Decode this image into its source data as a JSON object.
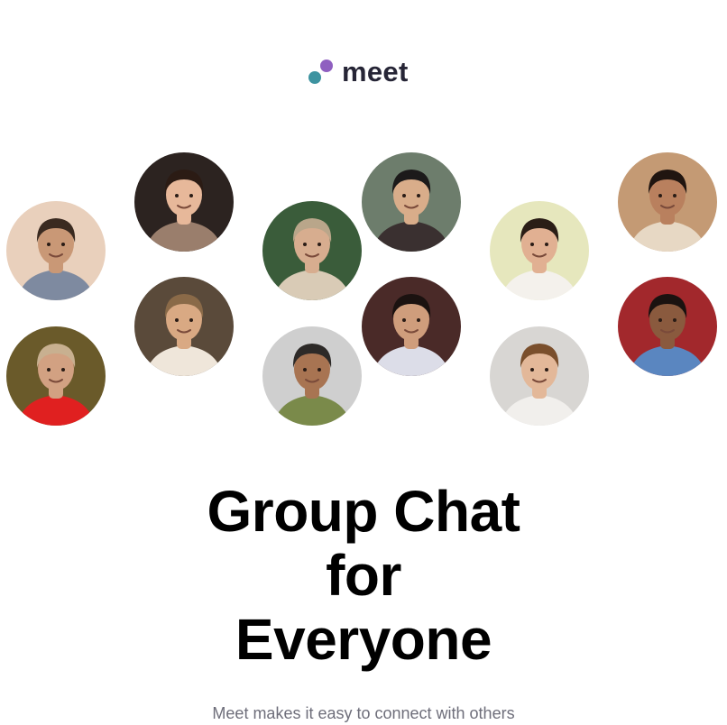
{
  "logo": {
    "wordmark": "meet",
    "colors": {
      "purple": "#8f5fc0",
      "teal": "#3d93a0",
      "text": "#262536"
    }
  },
  "avatars": [
    {
      "name": "avatar-young-man-sunset",
      "bg": "#e9d0bc",
      "skin": "#c99876",
      "hair": "#3a2a20",
      "shirt": "#7e8aa0"
    },
    {
      "name": "avatar-smiling-woman-dark-hair",
      "bg": "#2c2320",
      "skin": "#e7b89a",
      "hair": "#2b1b14",
      "shirt": "#9a7e6c"
    },
    {
      "name": "avatar-man-glasses-shearling",
      "bg": "#3a5c3a",
      "skin": "#d7ad8f",
      "hair": "#b9a68a",
      "shirt": "#d9cbb6"
    },
    {
      "name": "avatar-man-sunglasses",
      "bg": "#6d7d6c",
      "skin": "#d9ad8a",
      "hair": "#1c1a1a",
      "shirt": "#3a3030"
    },
    {
      "name": "avatar-smiling-man-green-bg",
      "bg": "#e6e7bd",
      "skin": "#e1b092",
      "hair": "#2a1d16",
      "shirt": "#f4f1ec"
    },
    {
      "name": "avatar-couple-autumn",
      "bg": "#c49a74",
      "skin": "#b9805e",
      "hair": "#201510",
      "shirt": "#e7d8c4"
    },
    {
      "name": "avatar-woman-laughing-sunlight",
      "bg": "#5a4a3a",
      "skin": "#d9a983",
      "hair": "#8a6a48",
      "shirt": "#efe6da"
    },
    {
      "name": "avatar-man-curly-hair-pink-bg",
      "bg": "#4a2a28",
      "skin": "#cf9d7c",
      "hair": "#1b1210",
      "shirt": "#dcdde8"
    },
    {
      "name": "avatar-man-hood-red-shirt",
      "bg": "#6a5a2a",
      "skin": "#d2a182",
      "hair": "#c8b090",
      "shirt": "#e02020"
    },
    {
      "name": "avatar-older-man-smiling",
      "bg": "#cfcfcf",
      "skin": "#a87452",
      "hair": "#2d2a28",
      "shirt": "#7a8a4a"
    },
    {
      "name": "avatar-young-man-wavy-hair",
      "bg": "#d8d6d3",
      "skin": "#e3b899",
      "hair": "#7a4f2c",
      "shirt": "#f1efec"
    },
    {
      "name": "avatar-woman-red-wall",
      "bg": "#a2282c",
      "skin": "#8a5a3e",
      "hair": "#1a1210",
      "shirt": "#5a86c0"
    }
  ],
  "hero": {
    "line1": "Group Chat",
    "line2": "for",
    "line3": "Everyone"
  },
  "subtitle": "Meet makes it easy to connect with others"
}
